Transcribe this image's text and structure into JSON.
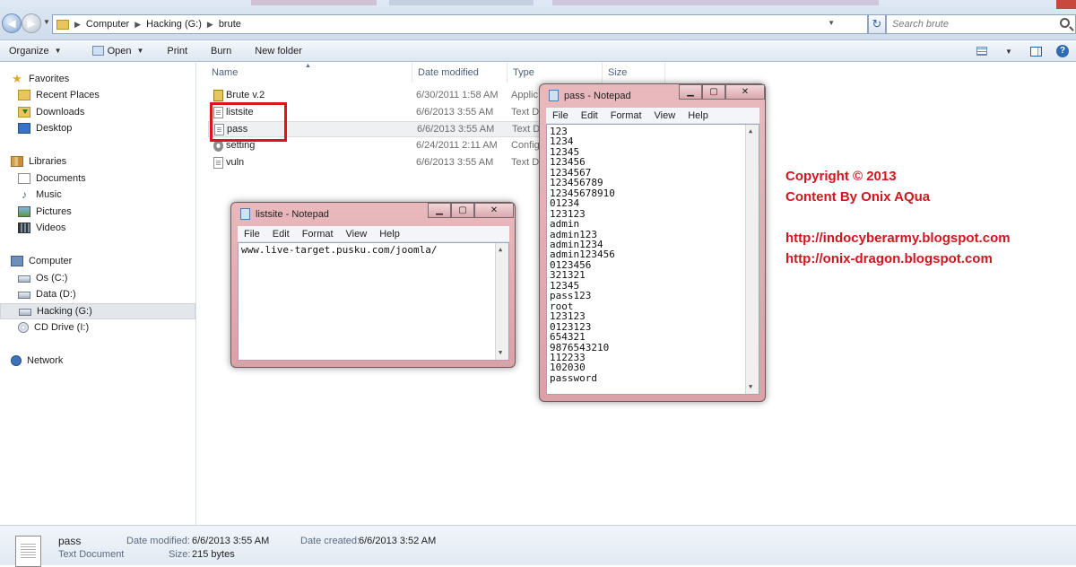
{
  "explorer": {
    "breadcrumb": [
      "Computer",
      "Hacking (G:)",
      "brute"
    ],
    "search_placeholder": "Search brute",
    "toolbar": {
      "organize": "Organize",
      "open": "Open",
      "print": "Print",
      "burn": "Burn",
      "new_folder": "New folder"
    },
    "nav": {
      "favorites": "Favorites",
      "recent_places": "Recent Places",
      "downloads": "Downloads",
      "desktop": "Desktop",
      "libraries": "Libraries",
      "documents": "Documents",
      "music": "Music",
      "pictures": "Pictures",
      "videos": "Videos",
      "computer": "Computer",
      "os_c": "Os (C:)",
      "data_d": "Data (D:)",
      "hacking_g": "Hacking (G:)",
      "cd_drive": "CD Drive (I:)",
      "network": "Network"
    },
    "columns": {
      "name": "Name",
      "date_modified": "Date modified",
      "type": "Type",
      "size": "Size"
    },
    "files": [
      {
        "name": "Brute v.2",
        "date": "6/30/2011 1:58 AM",
        "type": "Applic",
        "icon": "application-icon"
      },
      {
        "name": "listsite",
        "date": "6/6/2013 3:55 AM",
        "type": "Text D",
        "icon": "text-file-icon"
      },
      {
        "name": "pass",
        "date": "6/6/2013 3:55 AM",
        "type": "Text D",
        "icon": "text-file-icon"
      },
      {
        "name": "setting",
        "date": "6/24/2011 2:11 AM",
        "type": "Config",
        "icon": "config-file-icon"
      },
      {
        "name": "vuln",
        "date": "6/6/2013 3:55 AM",
        "type": "Text D",
        "icon": "text-file-icon"
      }
    ],
    "details": {
      "name": "pass",
      "kind": "Text Document",
      "modified_label": "Date modified:",
      "modified_value": "6/6/2013 3:55 AM",
      "size_label": "Size:",
      "size_value": "215 bytes",
      "created_label": "Date created:",
      "created_value": "6/6/2013 3:52 AM"
    }
  },
  "notepad_listsite": {
    "title": "listsite - Notepad",
    "menu": [
      "File",
      "Edit",
      "Format",
      "View",
      "Help"
    ],
    "content": "www.live-target.pusku.com/joomla/"
  },
  "notepad_pass": {
    "title": "pass - Notepad",
    "menu": [
      "File",
      "Edit",
      "Format",
      "View",
      "Help"
    ],
    "lines": [
      "123",
      "1234",
      "12345",
      "123456",
      "1234567",
      "123456789",
      "12345678910",
      "01234",
      "123123",
      "admin",
      "admin123",
      "admin1234",
      "admin123456",
      "0123456",
      "321321",
      "12345",
      "pass123",
      "root",
      "123123",
      "0123123",
      "654321",
      "9876543210",
      "112233",
      "102030",
      "password"
    ]
  },
  "credits": {
    "copyright": "Copyright © 2013",
    "content_by": "Content By Onix AQua",
    "url1": "http://indocyberarmy.blogspot.com",
    "url2": "http://onix-dragon.blogspot.com"
  },
  "colors": {
    "highlight_box": "#e0121d",
    "credits_text": "#d2161e",
    "notepad_frame": "#dba1a6"
  }
}
